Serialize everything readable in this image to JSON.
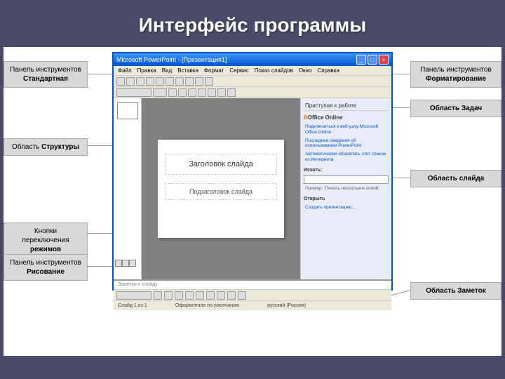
{
  "title": "Интерфейс программы",
  "labels": {
    "l1_a": "Панель инструментов",
    "l1_b": "Стандартная",
    "l2_a": "Область",
    "l2_b": "Структуры",
    "l3_a": "Кнопки переключения",
    "l3_b": "режимов",
    "l4_a": "Панель инструментов",
    "l4_b": "Рисование",
    "r1_a": "Панель инструментов",
    "r1_b": "Форматирование",
    "r2": "Область Задач",
    "r3": "Область слайда",
    "r4": "Область Заметок"
  },
  "win": {
    "title": "Microsoft PowerPoint - [Презентация1]",
    "menu": [
      "Файл",
      "Правка",
      "Вид",
      "Вставка",
      "Формат",
      "Сервис",
      "Показ слайдов",
      "Окно",
      "Справка"
    ],
    "slide_title": "Заголовок слайда",
    "slide_sub": "Подзаголовок слайда",
    "task_header": "Приступая к работе",
    "office": "Office Online",
    "tlinks": [
      "Подключиться к веб-узлу Microsoft Office Online",
      "Последние сведения об использовании PowerPoint",
      "Автоматически обновлять этот список из Интернета"
    ],
    "search": "Искать:",
    "example": "Пример: 'Печать нескольких копий'",
    "open": "Открыть",
    "create": "Создать презентацию...",
    "notes": "Заметки к слайду",
    "status": [
      "Слайд 1 из 1",
      "Оформление по умолчанию",
      "русский (Россия)"
    ]
  }
}
